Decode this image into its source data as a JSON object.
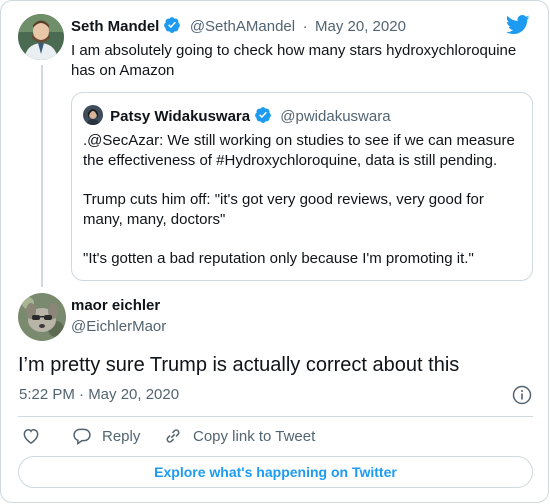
{
  "tweet": {
    "author_name": "Seth Mandel",
    "author_handle": "@SethAMandel",
    "separator": "·",
    "date": "May 20, 2020",
    "text": "I am absolutely going to check how many stars hydroxychloroquine has on Amazon"
  },
  "quote": {
    "author_name": "Patsy Widakuswara",
    "author_handle": "@pwidakuswara",
    "paragraphs": [
      ".@SecAzar: We still working on studies to see if we can measure the effectiveness of #Hydroxychloroquine, data is still pending.",
      "Trump cuts him off: \"it's got very good reviews, very good for many, many, doctors\"",
      "\"It's gotten a bad reputation only because I'm promoting it.\""
    ]
  },
  "reply": {
    "author_name": "maor eichler",
    "author_handle": "@EichlerMaor",
    "text": "I’m pretty sure Trump is actually correct about this",
    "timestamp": "5:22 PM · May 20, 2020"
  },
  "actions": {
    "reply_label": "Reply",
    "copy_label": "Copy link to Tweet"
  },
  "explore_label": "Explore what's happening on Twitter",
  "colors": {
    "accent": "#1d9bf0",
    "text": "#0f1419",
    "muted": "#536471",
    "border": "#cfd9de"
  },
  "icons": [
    "twitter-bird-icon",
    "verified-badge-icon",
    "info-icon",
    "heart-icon",
    "reply-icon",
    "link-icon"
  ]
}
